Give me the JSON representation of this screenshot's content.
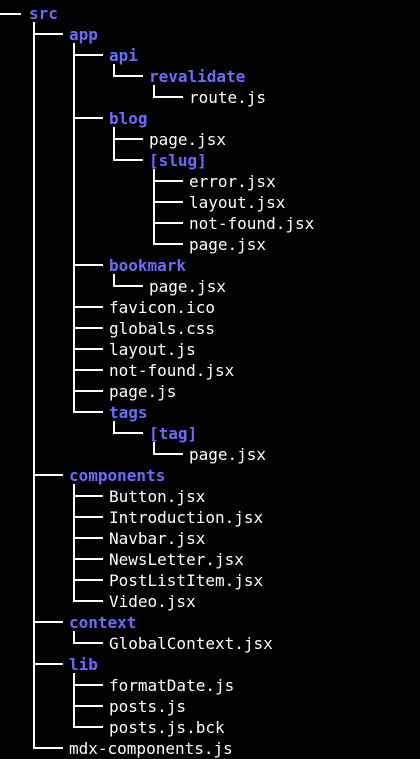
{
  "tree": [
    {
      "name": "src",
      "type": "dir",
      "depth": 0
    },
    {
      "name": "app",
      "type": "dir",
      "depth": 1
    },
    {
      "name": "api",
      "type": "dir",
      "depth": 2
    },
    {
      "name": "revalidate",
      "type": "dir",
      "depth": 3
    },
    {
      "name": "route.js",
      "type": "file",
      "depth": 4
    },
    {
      "name": "blog",
      "type": "dir",
      "depth": 2
    },
    {
      "name": "page.jsx",
      "type": "file",
      "depth": 3
    },
    {
      "name": "[slug]",
      "type": "dir",
      "depth": 3
    },
    {
      "name": "error.jsx",
      "type": "file",
      "depth": 4
    },
    {
      "name": "layout.jsx",
      "type": "file",
      "depth": 4
    },
    {
      "name": "not-found.jsx",
      "type": "file",
      "depth": 4
    },
    {
      "name": "page.jsx",
      "type": "file",
      "depth": 4
    },
    {
      "name": "bookmark",
      "type": "dir",
      "depth": 2
    },
    {
      "name": "page.jsx",
      "type": "file",
      "depth": 3
    },
    {
      "name": "favicon.ico",
      "type": "file",
      "depth": 2
    },
    {
      "name": "globals.css",
      "type": "file",
      "depth": 2
    },
    {
      "name": "layout.js",
      "type": "file",
      "depth": 2
    },
    {
      "name": "not-found.jsx",
      "type": "file",
      "depth": 2
    },
    {
      "name": "page.js",
      "type": "file",
      "depth": 2
    },
    {
      "name": "tags",
      "type": "dir",
      "depth": 2
    },
    {
      "name": "[tag]",
      "type": "dir",
      "depth": 3
    },
    {
      "name": "page.jsx",
      "type": "file",
      "depth": 4
    },
    {
      "name": "components",
      "type": "dir",
      "depth": 1
    },
    {
      "name": "Button.jsx",
      "type": "file",
      "depth": 2
    },
    {
      "name": "Introduction.jsx",
      "type": "file",
      "depth": 2
    },
    {
      "name": "Navbar.jsx",
      "type": "file",
      "depth": 2
    },
    {
      "name": "NewsLetter.jsx",
      "type": "file",
      "depth": 2
    },
    {
      "name": "PostListItem.jsx",
      "type": "file",
      "depth": 2
    },
    {
      "name": "Video.jsx",
      "type": "file",
      "depth": 2
    },
    {
      "name": "context",
      "type": "dir",
      "depth": 1
    },
    {
      "name": "GlobalContext.jsx",
      "type": "file",
      "depth": 2
    },
    {
      "name": "lib",
      "type": "dir",
      "depth": 1
    },
    {
      "name": "formatDate.js",
      "type": "file",
      "depth": 2
    },
    {
      "name": "posts.js",
      "type": "file",
      "depth": 2
    },
    {
      "name": "posts.js.bck",
      "type": "file",
      "depth": 2
    },
    {
      "name": "mdx-components.js",
      "type": "file",
      "depth": 1
    }
  ],
  "colors": {
    "background": "#000000",
    "directory": "#6a6bff",
    "file": "#ffffff",
    "connector": "#ffffff"
  }
}
